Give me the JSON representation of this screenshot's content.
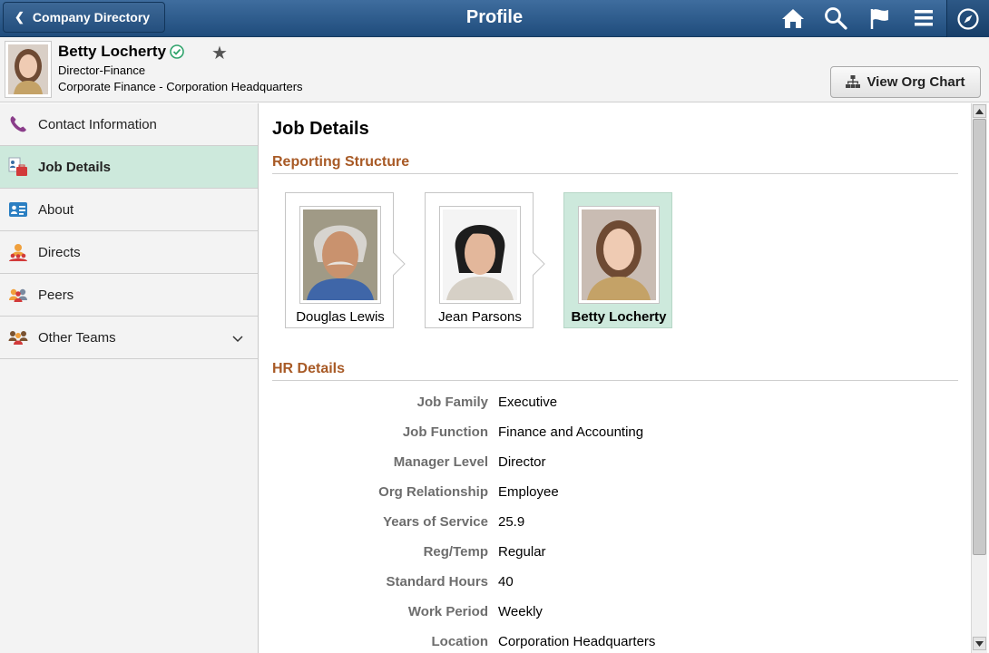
{
  "banner": {
    "back_label": "Company Directory",
    "title": "Profile",
    "icons": [
      "home-icon",
      "search-icon",
      "flag-icon",
      "menu-icon",
      "compass-icon"
    ]
  },
  "profile": {
    "name": "Betty Locherty",
    "title": "Director-Finance",
    "department": "Corporate Finance - Corporation Headquarters",
    "view_org_chart": "View Org Chart"
  },
  "sidebar": {
    "items": [
      {
        "label": "Contact Information",
        "icon": "phone-icon"
      },
      {
        "label": "Job Details",
        "icon": "job-details-icon",
        "active": true
      },
      {
        "label": "About",
        "icon": "id-card-icon"
      },
      {
        "label": "Directs",
        "icon": "directs-icon"
      },
      {
        "label": "Peers",
        "icon": "peers-icon"
      },
      {
        "label": "Other Teams",
        "icon": "team-icon",
        "expandable": true
      }
    ]
  },
  "main": {
    "title": "Job Details",
    "reporting_title": "Reporting Structure",
    "reporting": [
      {
        "name": "Douglas Lewis"
      },
      {
        "name": "Jean Parsons"
      },
      {
        "name": "Betty Locherty",
        "current": true
      }
    ],
    "hr_title": "HR Details",
    "hr_details": [
      {
        "label": "Job Family",
        "value": "Executive"
      },
      {
        "label": "Job Function",
        "value": "Finance and Accounting"
      },
      {
        "label": "Manager Level",
        "value": "Director"
      },
      {
        "label": "Org Relationship",
        "value": "Employee"
      },
      {
        "label": "Years of Service",
        "value": "25.9"
      },
      {
        "label": "Reg/Temp",
        "value": "Regular"
      },
      {
        "label": "Standard Hours",
        "value": "40"
      },
      {
        "label": "Work Period",
        "value": "Weekly"
      },
      {
        "label": "Location",
        "value": "Corporation Headquarters"
      }
    ]
  },
  "colors": {
    "banner": "#2b5a8a",
    "active_item": "#cde9dc",
    "section_title": "#a85a26"
  }
}
